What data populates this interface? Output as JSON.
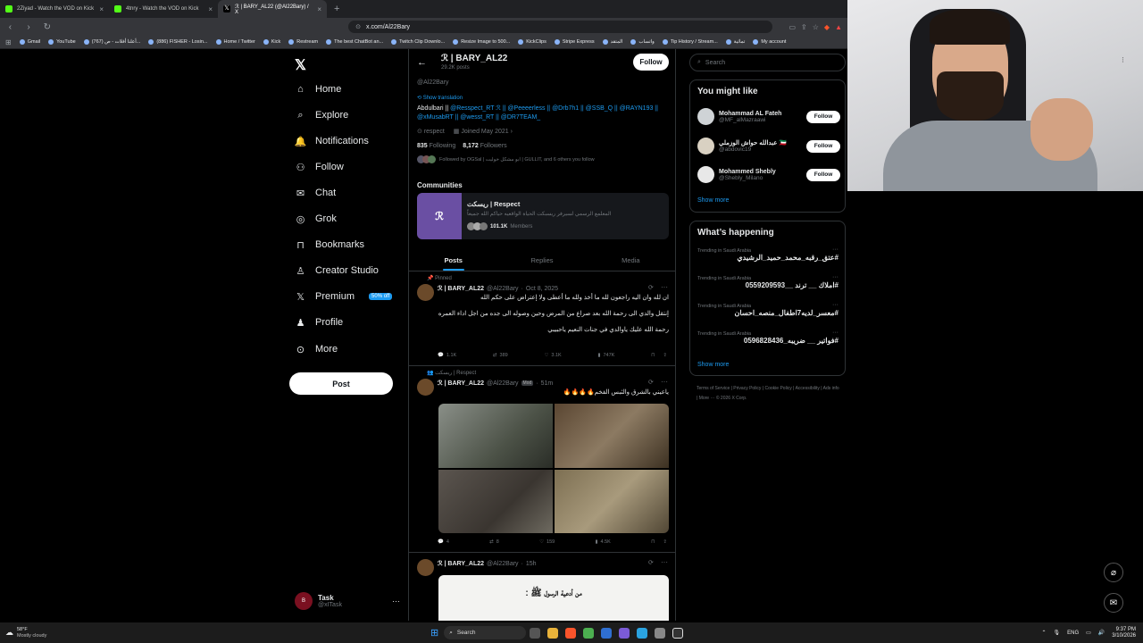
{
  "browser": {
    "tabs": [
      {
        "title": "2Ziyad - Watch the VOD on Kick",
        "color": "#53fc18",
        "active": false
      },
      {
        "title": "4tnry - Watch the VOD on Kick",
        "color": "#53fc18",
        "active": false
      },
      {
        "title": "ℛ | BARY_AL22 (@Al22Bary) / X",
        "color": "#ffffff",
        "active": true
      }
    ],
    "url": "x.com/Al22Bary",
    "bookmarks": [
      "Gmail",
      "YouTube",
      "(767) أعلنا أفلات - ص...",
      "(886) FISHER - Losin...",
      "Home / Twitter",
      "Kick",
      "Restream",
      "The best ChatBot an...",
      "Twitch Clip Downlo...",
      "Resize Image to 500...",
      "KickClips",
      "Stripe Express",
      "المتقد",
      "واتساب",
      "Tip History / Stream...",
      "تماثية",
      "My account"
    ]
  },
  "nav": {
    "items": [
      "Home",
      "Explore",
      "Notifications",
      "Follow",
      "Chat",
      "Grok",
      "Bookmarks",
      "Creator Studio",
      "Premium",
      "Profile",
      "More"
    ],
    "premium_badge": "50% off",
    "post_label": "Post",
    "account": {
      "name": "Task",
      "handle": "@xITask"
    }
  },
  "profile": {
    "name": "ℛ | BARY_AL22",
    "posts": "29.2K posts",
    "follow_label": "Follow",
    "handle": "@Al22Bary",
    "show_translation": "Show translation",
    "bio_prefix": "Abdulbari || ",
    "bio_links": "@Resspect_RT ℛ || @Peeeerless || @Drb7h1 || @SSB_Q || @RAYN193 || @xMusabRT || @wesst_RT || @DR7TEAM_",
    "location": "respect",
    "joined": "Joined May 2021",
    "following_count": "835",
    "following_label": "Following",
    "followers_count": "8,172",
    "followers_label": "Followers",
    "followed_by": "Followed by OGSal | ابو مشكل خوليت | GULLIT, and 6 others you follow",
    "communities_heading": "Communities",
    "community": {
      "name": "ريسكت | Respect",
      "desc": "المعلمع الرسمي لسيرفر ريسبكت الحياة الواقعيه حياكم الله جميعاً",
      "members": "101.1K",
      "members_label": "Members"
    },
    "tabs": [
      "Posts",
      "Replies",
      "Media"
    ]
  },
  "tweets": [
    {
      "context": "Pinned",
      "name": "ℛ | BARY_AL22",
      "handle": "@Al22Bary",
      "time": "Oct 8, 2025",
      "lines": [
        "ان لله وان اليه راجعون لله ما أخذ ولله ما أعطى ولا إعتراض على حكم الله",
        "",
        "إنتقل والدي الى رحمة الله بعد صراع من المرض وحين وصوله الى جده من اجل اداء العمره",
        "",
        "رحمة الله عليك ياوالدي في جنات النعيم ياحبيبي"
      ],
      "stats": {
        "reply": "1.1K",
        "retweet": "389",
        "like": "3.1K",
        "views": "747K"
      }
    },
    {
      "context": "ريسكت | Respect",
      "name": "ℛ | BARY_AL22",
      "handle": "@Al22Bary",
      "mod": "Mod",
      "time": "51m",
      "lines": [
        "ياعيني بالشرق والثبس الفخم🔥🔥🔥🔥"
      ],
      "stats": {
        "reply": "4",
        "retweet": "8",
        "like": "159",
        "views": "4.5K"
      }
    },
    {
      "name": "ℛ | BARY_AL22",
      "handle": "@Al22Bary",
      "time": "15h",
      "image_text": "من أدعية الرسول ﷺ :"
    }
  ],
  "right": {
    "search_placeholder": "Search",
    "wtf_heading": "You might like",
    "wtf": [
      {
        "name": "Mohammad AL Fateh",
        "handle": "@MF_alMazraawi"
      },
      {
        "name": "عبدالله حواش الوزملي 🇰🇼",
        "handle": "@abdovic19"
      },
      {
        "name": "Mohammed Shebly",
        "handle": "@Shebly_Milano"
      }
    ],
    "follow_label": "Follow",
    "show_more": "Show more",
    "trends_heading": "What’s happening",
    "trends": [
      {
        "cat": "Trending in Saudi Arabia",
        "tag": "#عتق_رقبه_محمد_حميد_الرشيدي"
      },
      {
        "cat": "Trending in Saudi Arabia",
        "tag": "#املاك __ ترند __0559209593"
      },
      {
        "cat": "Trending in Saudi Arabia",
        "tag": "#معسر_لديه7اطفال_منصه_احسان"
      },
      {
        "cat": "Trending in Saudi Arabia",
        "tag": "#فواتير __ ضريبه_0596828436"
      }
    ],
    "footer": "Terms of Service  |  Privacy Policy  |  Cookie Policy  |  Accessibility  |  Ads info  |  More ···  © 2026 X Corp."
  },
  "taskbar": {
    "weather_temp": "58°F",
    "weather_desc": "Mostly cloudy",
    "search": "Search",
    "lang": "ENG",
    "time": "9:37 PM",
    "date": "3/10/2026"
  }
}
